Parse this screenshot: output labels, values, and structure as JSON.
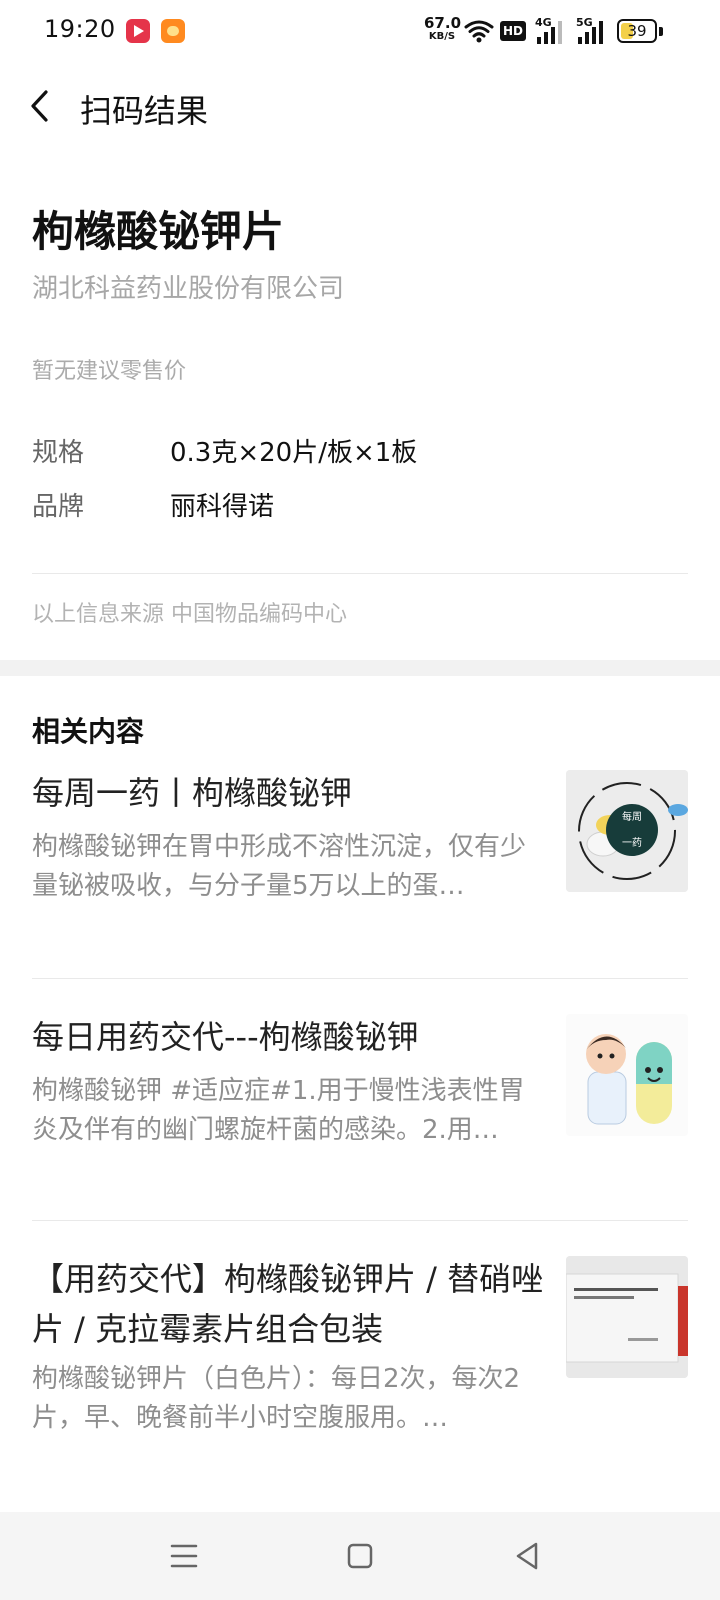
{
  "status_bar": {
    "time": "19:20",
    "network_speed_value": "67.0",
    "network_speed_unit": "KB/S",
    "hd_label": "HD",
    "net1_label": "4G",
    "net2_label": "5G",
    "battery_level": 39,
    "battery_text": "39"
  },
  "header": {
    "title": "扫码结果"
  },
  "product": {
    "name": "枸橼酸铋钾片",
    "company": "湖北科益药业股份有限公司",
    "price_note": "暂无建议零售价",
    "specs": [
      {
        "label": "规格",
        "value": "0.3克×20片/板×1板"
      },
      {
        "label": "品牌",
        "value": "丽科得诺"
      }
    ],
    "source_note": "以上信息来源 中国物品编码中心"
  },
  "related": {
    "title": "相关内容",
    "items": [
      {
        "title": "每周一药丨枸橼酸铋钾",
        "desc": "枸橼酸铋钾在胃中形成不溶性沉淀，仅有少量铋被吸收，与分子量5万以上的蛋…",
        "thumb_text": "每周一药"
      },
      {
        "title": "每日用药交代---枸橼酸铋钾",
        "desc": "枸橼酸铋钾 #适应症#1.用于慢性浅表性胃炎及伴有的幽门螺旋杆菌的感染。2.用…",
        "thumb_text": ""
      },
      {
        "title": "【用药交代】枸橼酸铋钾片 / 替硝唑片 / 克拉霉素片组合包装",
        "desc": "枸橼酸铋钾片（白色片）：每日2次，每次2片，早、晚餐前半小时空腹服用。…",
        "thumb_text": "枸橼酸铋钾片/替硝唑片/克拉霉素片组合包装"
      }
    ]
  },
  "colors": {
    "accent_battery": "#f3d04a",
    "divider": "#e9e9e9",
    "section_gap": "#f2f2f2"
  }
}
